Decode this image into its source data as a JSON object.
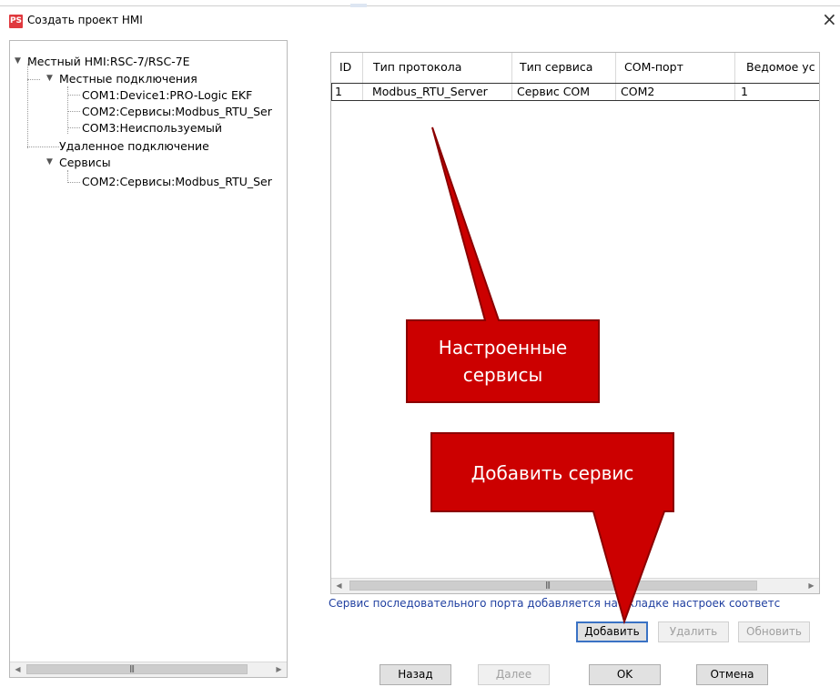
{
  "window": {
    "icon_text": "PS",
    "title": "Создать проект HMI",
    "close_glyph": "×"
  },
  "tree": {
    "root": "Местный HMI:RSC-7/RSC-7E",
    "local_connections": "Местные подключения",
    "com1": "COM1:Device1:PRO-Logic EKF",
    "com2": "COM2:Сервисы:Modbus_RTU_Ser",
    "com3": "COM3:Неиспользуемый",
    "remote_connection": "Удаленное подключение",
    "services": "Сервисы",
    "services_com2": "COM2:Сервисы:Modbus_RTU_Ser",
    "arrow_glyph": "▼",
    "scroll_left": "◀",
    "scroll_right": "▶",
    "scroll_grip": "|||"
  },
  "table": {
    "headers": [
      "ID",
      "Тип протокола",
      "Тип сервиса",
      "COM-порт",
      "Ведомое ус"
    ],
    "rows": [
      [
        "1",
        "Modbus_RTU_Server",
        "Сервис COM",
        "COM2",
        "1"
      ]
    ],
    "scroll_left": "◀",
    "scroll_right": "▶",
    "scroll_grip": "|||"
  },
  "info_text": "Сервис последовательного порта добавляется на вкладке настроек соответс",
  "buttons": {
    "add": "Добавить",
    "delete": "Удалить",
    "update": "Обновить",
    "back": "Назад",
    "next": "Далее",
    "ok": "OK",
    "cancel": "Отмена"
  },
  "callouts": {
    "configured_services_line1": "Настроенные",
    "configured_services_line2": "сервисы",
    "add_service": "Добавить сервис",
    "fill_color": "#cc0000",
    "stroke_color": "#8b0000"
  }
}
